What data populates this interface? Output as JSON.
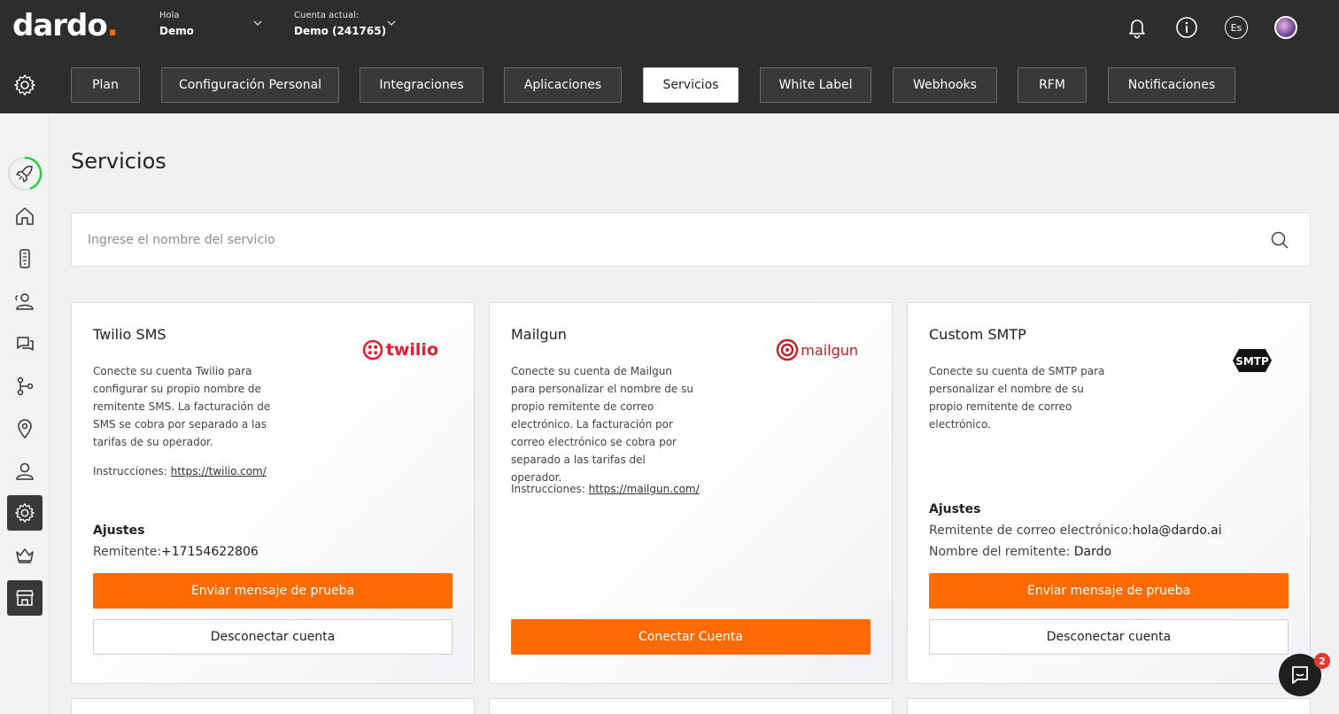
{
  "header": {
    "logo_main": "dardo",
    "logo_dot": ".",
    "greeting_label": "Hola",
    "user_name": "Demo",
    "account_label": "Cuenta actual:",
    "account_value": "Demo (241765)",
    "language": "Es"
  },
  "tabs": [
    {
      "label": "Plan"
    },
    {
      "label": "Configuración Personal"
    },
    {
      "label": "Integraciones"
    },
    {
      "label": "Aplicaciones"
    },
    {
      "label": "Servicios",
      "active": true
    },
    {
      "label": "White Label"
    },
    {
      "label": "Webhooks"
    },
    {
      "label": "RFM"
    },
    {
      "label": "Notificaciones"
    }
  ],
  "sidebar": {
    "items": [
      "rocket-icon",
      "home-icon",
      "phone-icon",
      "contacts-icon",
      "chat-icon",
      "flow-icon",
      "location-icon",
      "user-icon",
      "settings-icon",
      "crown-icon",
      "store-icon"
    ]
  },
  "page": {
    "title": "Servicios",
    "search_placeholder": "Ingrese el nombre del servicio"
  },
  "cards": [
    {
      "title": "Twilio SMS",
      "logo_text": "twilio",
      "description": "Conecte su cuenta Twilio para configurar su propio nombre de remitente SMS. La facturación de SMS se cobra por separado a las tarifas de su operador.",
      "instructions_label": "Instrucciones:",
      "instructions_link": "https://twilio.com/",
      "settings_title": "Ajustes",
      "sender_label": "Remitente:",
      "sender_value": "+17154622806",
      "test_button": "Enviar mensaje de prueba",
      "disconnect_button": "Desconectar cuenta"
    },
    {
      "title": "Mailgun",
      "logo_text": "mailgun",
      "description": "Conecte su cuenta de Mailgun para personalizar el nombre de su propio remitente de correo electrónico. La facturación por correo electrónico se cobra por separado a las tarifas del operador.",
      "instructions_label": "Instrucciones:",
      "instructions_link": "https://mailgun.com/",
      "connect_button": "Conectar Cuenta"
    },
    {
      "title": "Custom SMTP",
      "logo_text": "SMTP",
      "description": "Conecte su cuenta de SMTP para personalizar el nombre de su propio remitente de correo electrónico.",
      "settings_title": "Ajustes",
      "email_label": "Remitente de correo electrónico:",
      "email_value": "hola@dardo.ai",
      "name_label": "Nombre del remitente:",
      "name_value": "Dardo",
      "test_button": "Enviar mensaje de prueba",
      "disconnect_button": "Desconectar cuenta"
    }
  ],
  "chat": {
    "badge_count": "2"
  },
  "colors": {
    "accent": "#ff6b00",
    "header_bg": "#2f2c2c",
    "badge": "#e5372f"
  }
}
